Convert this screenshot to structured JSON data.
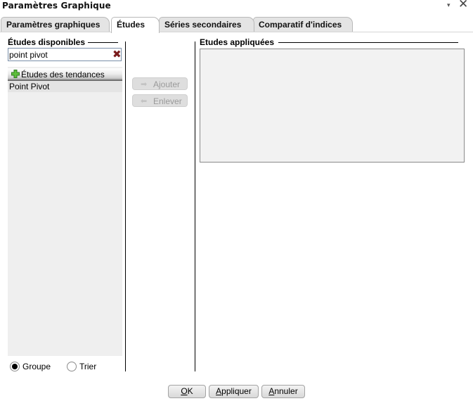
{
  "window": {
    "title": "Paramètres Graphique",
    "menu_glyph": "▾",
    "close_glyph": "✕"
  },
  "tabs": [
    {
      "label": "Paramètres graphiques",
      "active": false
    },
    {
      "label": "Études",
      "active": true
    },
    {
      "label": "Séries secondaires",
      "active": false
    },
    {
      "label": "Comparatif d'indices",
      "active": false
    }
  ],
  "available": {
    "heading": "Études disponibles",
    "search_value": "point pivot",
    "clear_glyph": "✖",
    "group_label": "Études des tendances",
    "items": [
      "Point Pivot"
    ]
  },
  "sort": {
    "options": [
      {
        "label": "Groupe",
        "selected": true
      },
      {
        "label": "Trier",
        "selected": false
      }
    ]
  },
  "actions": {
    "add_label": "Ajouter",
    "remove_label": "Enlever",
    "add_arrow": "➡",
    "remove_arrow": "⬅"
  },
  "applied": {
    "heading": "Etudes appliquées",
    "items": []
  },
  "footer": {
    "ok_underlined": "O",
    "ok_rest": "K",
    "apply_underlined": "A",
    "apply_rest": "ppliquer",
    "cancel_underlined": "A",
    "cancel_rest": "nnuler"
  },
  "colors": {
    "accent_clear": "#7a1c1c",
    "plus_green": "#3a9a2a",
    "disabled_text": "#9a9a9a"
  }
}
